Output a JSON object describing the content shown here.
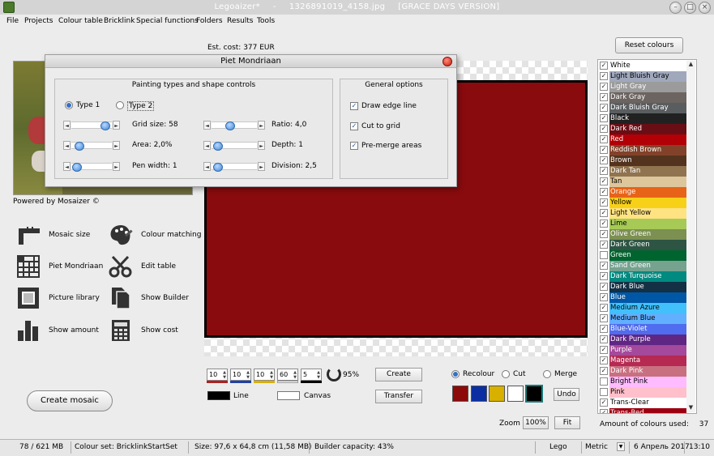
{
  "window": {
    "title_app": "Legoaizer*",
    "title_sep": "-",
    "title_file": "1326891019_4158.jpg",
    "title_edition": "[GRACE DAYS VERSION]"
  },
  "menu": [
    "File",
    "Projects",
    "Colour table",
    "Bricklink",
    "Special functions",
    "Folders",
    "Results",
    "Tools"
  ],
  "est_cost": "Est. cost: 377 EUR",
  "powered_by": "Powered by Mosaizer ©",
  "tools": [
    {
      "label": "Mosaic size",
      "icon": "ruler-icon"
    },
    {
      "label": "Colour matching",
      "icon": "palette-icon"
    },
    {
      "label": "Piet Mondriaan",
      "icon": "grid-icon"
    },
    {
      "label": "Edit table",
      "icon": "scissors-icon"
    },
    {
      "label": "Picture library",
      "icon": "picture-frame-icon"
    },
    {
      "label": "Show Builder",
      "icon": "pages-icon"
    },
    {
      "label": "Show amount",
      "icon": "bar-chart-icon"
    },
    {
      "label": "Show cost",
      "icon": "calculator-icon"
    }
  ],
  "create_mosaic": "Create mosaic",
  "spinners": [
    {
      "value": "10",
      "color": "#b02020"
    },
    {
      "value": "10",
      "color": "#2040a8"
    },
    {
      "value": "10",
      "color": "#d8b000"
    },
    {
      "value": "60",
      "color": "#ffffff"
    },
    {
      "value": "5",
      "color": "#000000"
    }
  ],
  "zoom_percent_spinner": "95%",
  "buttons": {
    "create": "Create",
    "transfer": "Transfer",
    "undo": "Undo",
    "fit": "Fit",
    "reset_colours": "Reset colours"
  },
  "modes": {
    "recolour": "Recolour",
    "cut": "Cut",
    "merge": "Merge",
    "selected": "recolour"
  },
  "paint_swatches": [
    "#8c0a0a",
    "#0b2fa2",
    "#d8b000",
    "#ffffff",
    "#000000"
  ],
  "legend": {
    "line": "Line",
    "canvas": "Canvas"
  },
  "zoom": {
    "label": "Zoom",
    "value": "100%"
  },
  "colours": [
    {
      "name": "White",
      "bg": "#ffffff",
      "fg": "#000000",
      "checked": true
    },
    {
      "name": "Light Bluish Gray",
      "bg": "#a0a8bc",
      "fg": "#000000",
      "checked": true
    },
    {
      "name": "Light Gray",
      "bg": "#9b9b9b",
      "fg": "#ffffff",
      "checked": true
    },
    {
      "name": "Dark Gray",
      "bg": "#6b6460",
      "fg": "#ffffff",
      "checked": true
    },
    {
      "name": "Dark Bluish Gray",
      "bg": "#595d60",
      "fg": "#ffffff",
      "checked": true
    },
    {
      "name": "Black",
      "bg": "#212121",
      "fg": "#ffffff",
      "checked": true
    },
    {
      "name": "Dark Red",
      "bg": "#6a0e15",
      "fg": "#ffffff",
      "checked": true
    },
    {
      "name": "Red",
      "bg": "#b30006",
      "fg": "#ffffff",
      "checked": true
    },
    {
      "name": "Reddish Brown",
      "bg": "#82422a",
      "fg": "#ffffff",
      "checked": true
    },
    {
      "name": "Brown",
      "bg": "#53331e",
      "fg": "#ffffff",
      "checked": true
    },
    {
      "name": "Dark Tan",
      "bg": "#907450",
      "fg": "#ffffff",
      "checked": true
    },
    {
      "name": "Tan",
      "bg": "#dec69c",
      "fg": "#000000",
      "checked": true
    },
    {
      "name": "Orange",
      "bg": "#e76318",
      "fg": "#ffffff",
      "checked": true
    },
    {
      "name": "Yellow",
      "bg": "#f7d117",
      "fg": "#000000",
      "checked": true
    },
    {
      "name": "Light Yellow",
      "bg": "#ffe383",
      "fg": "#000000",
      "checked": true
    },
    {
      "name": "Lime",
      "bg": "#a6ca55",
      "fg": "#000000",
      "checked": true
    },
    {
      "name": "Olive Green",
      "bg": "#7c9051",
      "fg": "#ffffff",
      "checked": true
    },
    {
      "name": "Dark Green",
      "bg": "#2e5543",
      "fg": "#ffffff",
      "checked": true
    },
    {
      "name": "Green",
      "bg": "#00642e",
      "fg": "#ffffff",
      "checked": false
    },
    {
      "name": "Sand Green",
      "bg": "#76a290",
      "fg": "#ffffff",
      "checked": true
    },
    {
      "name": "Dark Turquoise",
      "bg": "#008a80",
      "fg": "#ffffff",
      "checked": true
    },
    {
      "name": "Dark Blue",
      "bg": "#143044",
      "fg": "#ffffff",
      "checked": true
    },
    {
      "name": "Blue",
      "bg": "#0057a6",
      "fg": "#ffffff",
      "checked": true
    },
    {
      "name": "Medium Azure",
      "bg": "#42c0fb",
      "fg": "#000000",
      "checked": true
    },
    {
      "name": "Medium Blue",
      "bg": "#61afff",
      "fg": "#000000",
      "checked": true
    },
    {
      "name": "Blue-Violet",
      "bg": "#506cef",
      "fg": "#ffffff",
      "checked": true
    },
    {
      "name": "Dark Purple",
      "bg": "#5f2683",
      "fg": "#ffffff",
      "checked": true
    },
    {
      "name": "Purple",
      "bg": "#a5499c",
      "fg": "#ffffff",
      "checked": true
    },
    {
      "name": "Magenta",
      "bg": "#b52952",
      "fg": "#ffffff",
      "checked": true
    },
    {
      "name": "Dark Pink",
      "bg": "#c87080",
      "fg": "#ffffff",
      "checked": true
    },
    {
      "name": "Bright Pink",
      "bg": "#ffbbff",
      "fg": "#000000",
      "checked": false
    },
    {
      "name": "Pink",
      "bg": "#ffc0cb",
      "fg": "#000000",
      "checked": false
    },
    {
      "name": "Trans-Clear",
      "bg": "#ffffff",
      "fg": "#000000",
      "checked": true
    },
    {
      "name": "Trans-Red",
      "bg": "#9c0010",
      "fg": "#ffffff",
      "checked": true
    }
  ],
  "amount_used": "Amount of colours used:",
  "amount_value": "37",
  "status": {
    "memory": "78 / 621 MB",
    "colour_set": "Colour set: BricklinkStartSet",
    "size": "Size: 97,6 x 64,8 cm (11,58 MB)",
    "builder": "Builder capacity: 43%",
    "brand": "Lego",
    "unit": "Metric",
    "date": "6 Апрель 2017",
    "time": "13:10"
  },
  "dialog": {
    "title": "Piet Mondriaan",
    "painting_group": "Painting types and shape controls",
    "general_group": "General options",
    "type1": "Type 1",
    "type2": "Type 2",
    "selected_type": "type1",
    "left_sliders": [
      {
        "label": "Grid size: 58",
        "level": 0.78
      },
      {
        "label": "Area: 2,0%",
        "level": 0.1
      },
      {
        "label": "Pen width: 1",
        "level": 0.05
      }
    ],
    "right_sliders": [
      {
        "label": "Ratio: 4,0",
        "level": 0.4
      },
      {
        "label": "Depth: 1",
        "level": 0.22
      },
      {
        "label": "Division: 2,5",
        "level": 0.22
      }
    ],
    "options": [
      {
        "label": "Draw edge line",
        "checked": true
      },
      {
        "label": "Cut to grid",
        "checked": true
      },
      {
        "label": "Pre-merge areas",
        "checked": true
      }
    ]
  }
}
